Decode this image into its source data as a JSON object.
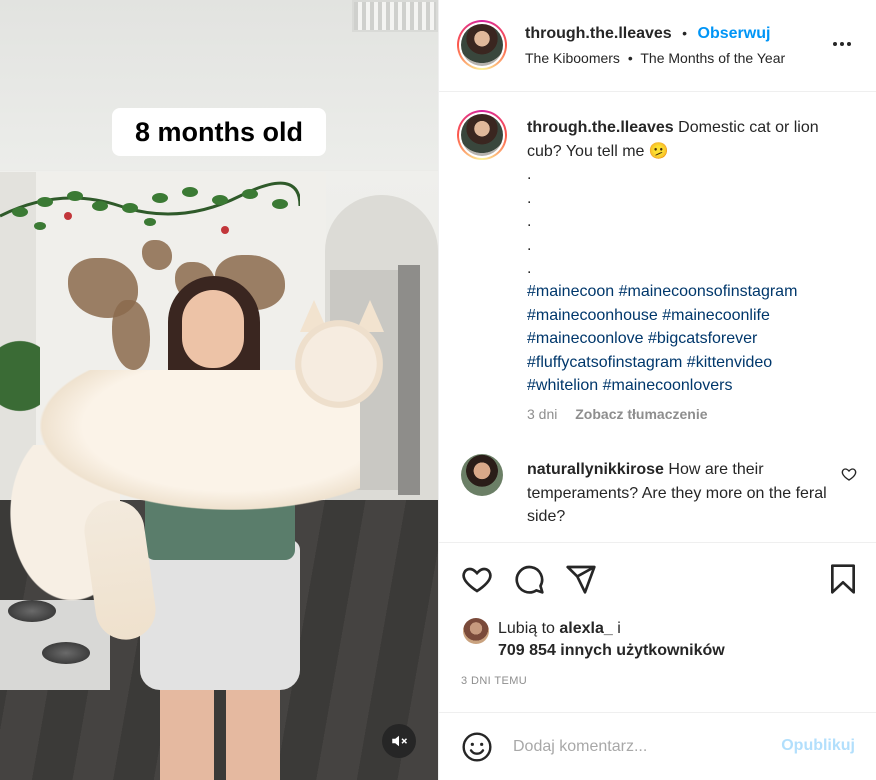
{
  "media": {
    "overlay_text": "8 months old",
    "mute_icon": "speaker-muted-icon"
  },
  "header": {
    "username": "through.the.lleaves",
    "separator": "•",
    "follow_label": "Obserwuj",
    "music_artist": "The Kiboomers",
    "music_separator": "•",
    "music_title": "The Months of the Year",
    "more_icon": "more-options-icon"
  },
  "caption": {
    "username": "through.the.lleaves",
    "text": "Domestic cat or lion cub? You tell me 🫤",
    "dots": [
      ".",
      ".",
      ".",
      ".",
      "."
    ],
    "hashtags": [
      "#mainecoon",
      "#mainecoonsofinstagram",
      "#mainecoonhouse",
      "#mainecoonlife",
      "#mainecoonlove",
      "#bigcatsforever",
      "#fluffycatsofinstagram",
      "#kittenvideo",
      "#whitelion",
      "#mainecoonlovers"
    ],
    "age": "3 dni",
    "translate_label": "Zobacz tłumaczenie"
  },
  "comment": {
    "username": "naturallynikkirose",
    "text": "How are their temperaments? Are they more on the feral side?",
    "like_icon": "heart-outline-icon"
  },
  "actions": {
    "like_icon": "heart-icon",
    "comment_icon": "comment-icon",
    "share_icon": "share-icon",
    "save_icon": "bookmark-icon"
  },
  "likes": {
    "prefix": "Lubią to",
    "user": "alexla_",
    "suffix": "i",
    "count_text": "709 854 innych użytkowników"
  },
  "timestamp": "3 DNI TEMU",
  "add_comment": {
    "emoji_icon": "emoji-icon",
    "placeholder": "Dodaj komentarz...",
    "publish_label": "Opublikuj"
  },
  "colors": {
    "accent": "#0095f6",
    "hashtag": "#00376b",
    "muted": "#8e8e8e",
    "publish_disabled": "#b2dffc"
  }
}
